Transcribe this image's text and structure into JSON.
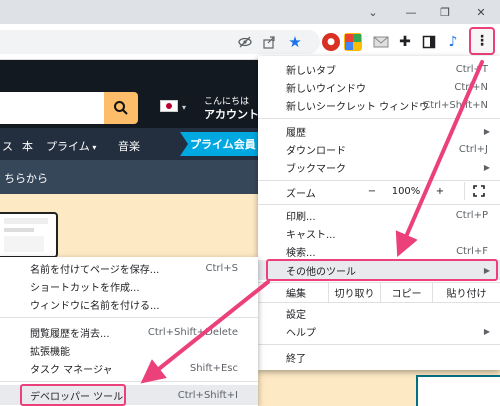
{
  "window": {
    "minimize_glyph": "⌄",
    "min_glyph": "—",
    "restore_glyph": "❐",
    "close_glyph": "✕"
  },
  "toolbar": {
    "icons": [
      "eye-off-icon",
      "share-icon",
      "bookmark-star-icon",
      "extension-red-icon",
      "extension-blue-icon",
      "extension-mail-icon",
      "extensions-puzzle-icon",
      "side-panel-icon",
      "music-icon",
      "kebab-menu-icon"
    ],
    "menu_glyph": "⋮"
  },
  "page": {
    "greeting": "こんにちは",
    "account": "アカウント",
    "nav_items": [
      "ス",
      "本",
      "プライム",
      "音楽"
    ],
    "prime_banner": "プライム会員",
    "band_text": "ちらから"
  },
  "menu": {
    "new_tab": {
      "label": "新しいタブ",
      "shortcut": "Ctrl+T"
    },
    "new_window": {
      "label": "新しいウインドウ",
      "shortcut": "Ctrl+N"
    },
    "incognito": {
      "label": "新しいシークレット ウィンドウ",
      "shortcut": "Ctrl+Shift+N"
    },
    "history": {
      "label": "履歴"
    },
    "downloads": {
      "label": "ダウンロード",
      "shortcut": "Ctrl+J"
    },
    "bookmarks": {
      "label": "ブックマーク"
    },
    "zoom": {
      "label": "ズーム",
      "minus": "−",
      "value": "100%",
      "plus": "+"
    },
    "print": {
      "label": "印刷...",
      "shortcut": "Ctrl+P"
    },
    "cast": {
      "label": "キャスト..."
    },
    "find": {
      "label": "検索...",
      "shortcut": "Ctrl+F"
    },
    "more_tools": {
      "label": "その他のツール"
    },
    "edit": {
      "label": "編集",
      "cut": "切り取り",
      "copy": "コピー",
      "paste": "貼り付け"
    },
    "settings": {
      "label": "設定"
    },
    "help": {
      "label": "ヘルプ"
    },
    "exit": {
      "label": "終了"
    }
  },
  "submenu": {
    "save_page": {
      "label": "名前を付けてページを保存...",
      "shortcut": "Ctrl+S"
    },
    "create_shortcut": {
      "label": "ショートカットを作成..."
    },
    "name_window": {
      "label": "ウィンドウに名前を付ける..."
    },
    "clear_data": {
      "label": "閲覧履歴を消去...",
      "shortcut": "Ctrl+Shift+Delete"
    },
    "extensions": {
      "label": "拡張機能"
    },
    "task_manager": {
      "label": "タスク マネージャ",
      "shortcut": "Shift+Esc"
    },
    "devtools": {
      "label": "デベロッパー ツール",
      "shortcut": "Ctrl+Shift+I"
    }
  },
  "colors": {
    "highlight": "#ec407a",
    "amazon_dark": "#131921",
    "amazon_nav": "#232f3e",
    "prime_blue": "#00a8e1",
    "search_orange": "#febd69"
  }
}
